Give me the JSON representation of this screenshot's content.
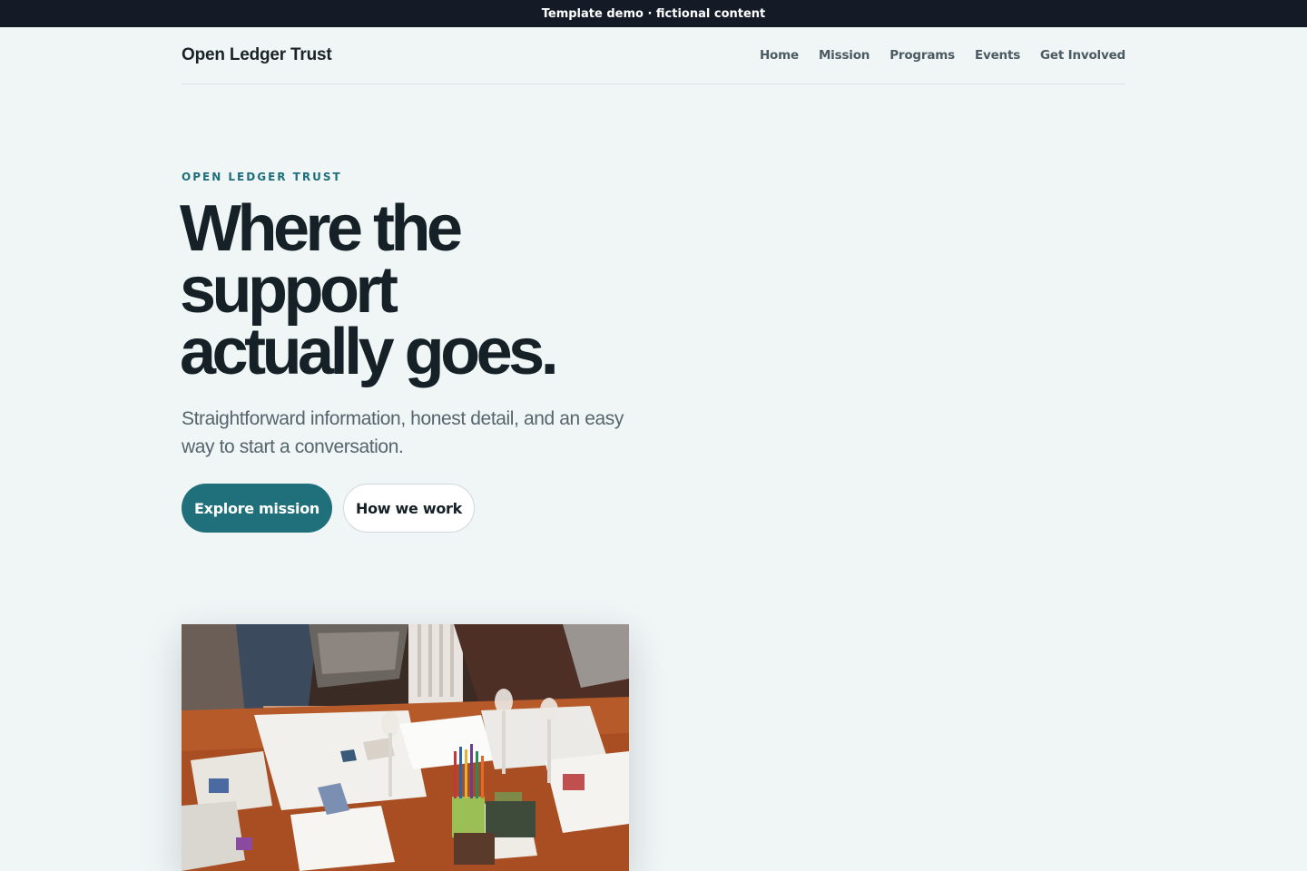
{
  "banner": {
    "text": "Template demo · fictional content"
  },
  "nav": {
    "brand": "Open Ledger Trust",
    "links": [
      "Home",
      "Mission",
      "Programs",
      "Events",
      "Get Involved"
    ]
  },
  "hero": {
    "eyebrow": "OPEN LEDGER TRUST",
    "headline_lines": [
      "Where the",
      "support",
      "actually goes."
    ],
    "subtext": "Straightforward information, honest detail, and an easy way to start a conversation.",
    "primary_button": "Explore mission",
    "secondary_button": "How we work"
  },
  "colors": {
    "background": "#f0f5f6",
    "banner": "#141b27",
    "accent": "#20707b",
    "heading": "#152127"
  }
}
